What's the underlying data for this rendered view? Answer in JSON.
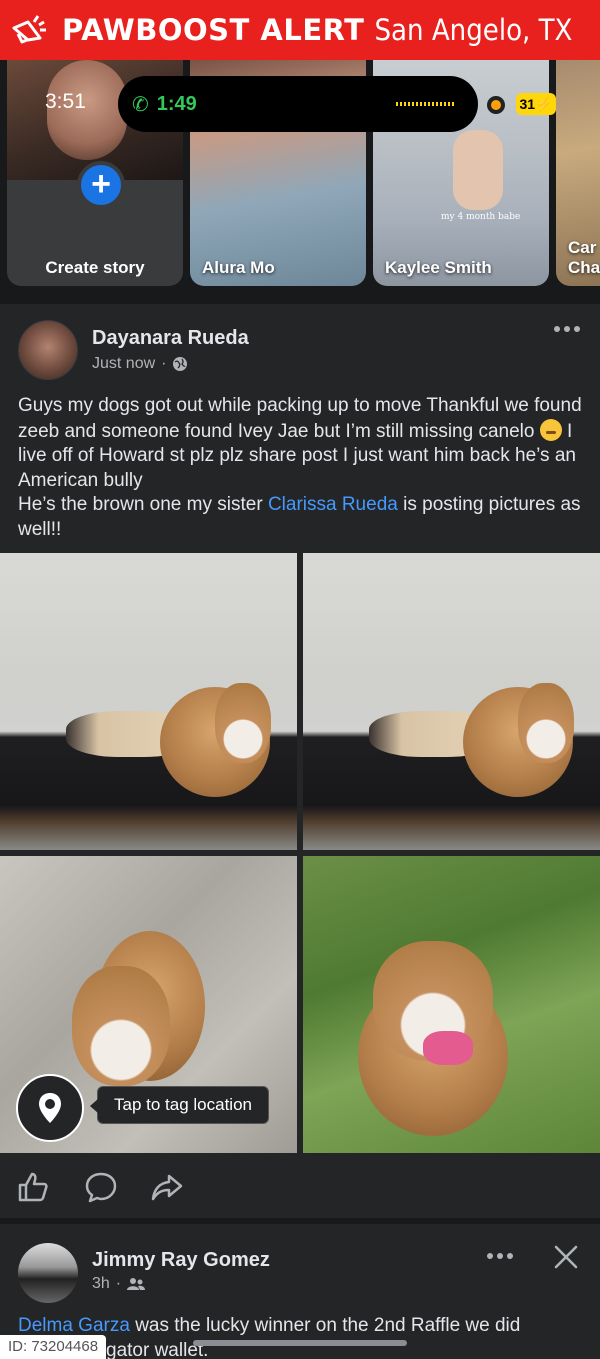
{
  "alert_banner": {
    "brand": "PAWBOOST ALERT",
    "city": "San Angelo, TX",
    "icon": "megaphone-icon",
    "color": "#e8201e"
  },
  "status": {
    "time": "3:51",
    "call_time": "1:49",
    "battery": "31"
  },
  "stories": [
    {
      "label": "Create story"
    },
    {
      "label": "Alura Mo"
    },
    {
      "label": "Kaylee Smith",
      "caption": "my 4 month babe"
    },
    {
      "label": "Car Cha"
    }
  ],
  "post": {
    "author": "Dayanara Rueda",
    "time": "Just now",
    "privacy_icon": "globe-icon",
    "text_before_emoji": "Guys my dogs got out while packing up to move Thankful we found zeeb and someone found Ivey Jae but I’m still missing canelo ",
    "text_after_emoji": " I live off of Howard st plz plz share post I just want him back he’s an American bully",
    "text_line2_before": "He’s the brown one my sister ",
    "mention": "Clarissa Rueda",
    "text_line2_after": " is posting pictures as well!!",
    "tag_location": "Tap to tag location"
  },
  "post2": {
    "author": "Jimmy Ray Gomez",
    "time": "3h",
    "audience_icon": "friends-icon",
    "mention": "Delma Garza",
    "text_after": " was the lucky winner on the 2nd Raffle we did",
    "text_line2": "gator wallet."
  },
  "id_badge": "ID: 73204468",
  "colors": {
    "background": "#242526",
    "link": "#4599ff",
    "accent": "#1b74e4"
  }
}
